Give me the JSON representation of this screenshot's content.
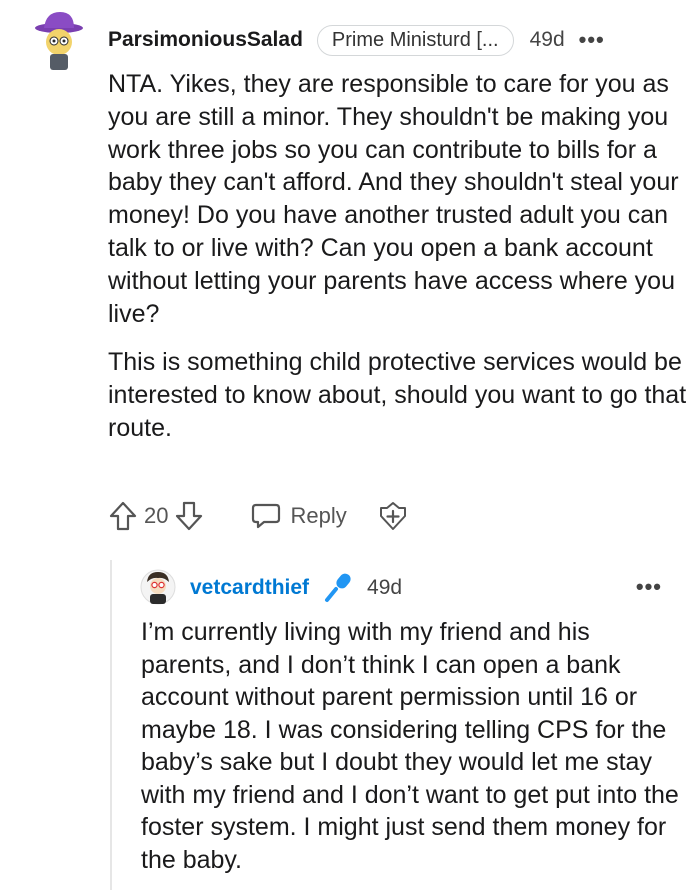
{
  "comment": {
    "username": "ParsimoniousSalad",
    "flair": "Prime Ministurd [...",
    "age": "49d",
    "more_label": "•••",
    "paragraphs": [
      "NTA. Yikes, they are responsible to care for you as you are still a minor. They shouldn't be making you work three jobs so you can contribute to bills for a baby they can't afford. And they shouldn't steal your money! Do you have another trusted adult you can talk to or live with? Can you open a bank account without letting your parents have access where you live?",
      "This is something child protective services would be interested to know about, should you want to go that route."
    ],
    "votes": "20",
    "reply_label": "Reply"
  },
  "reply": {
    "username": "vetcardthief",
    "age": "49d",
    "more_label": "•••",
    "text": "I’m currently living with my friend and his parents, and I don’t think I can open a bank account without parent permission until 16 or maybe 18. I was considering telling CPS for the baby’s sake but I doubt they would let me stay with my friend and I don’t want to get put into the foster system. I might just send them money for the baby."
  },
  "colors": {
    "username_reply": "#0079d3",
    "text": "#1a1a1b",
    "meta": "#555555"
  },
  "icons": [
    "upvote-icon",
    "downvote-icon",
    "reply-icon",
    "award-icon",
    "microphone-icon",
    "more-icon"
  ]
}
